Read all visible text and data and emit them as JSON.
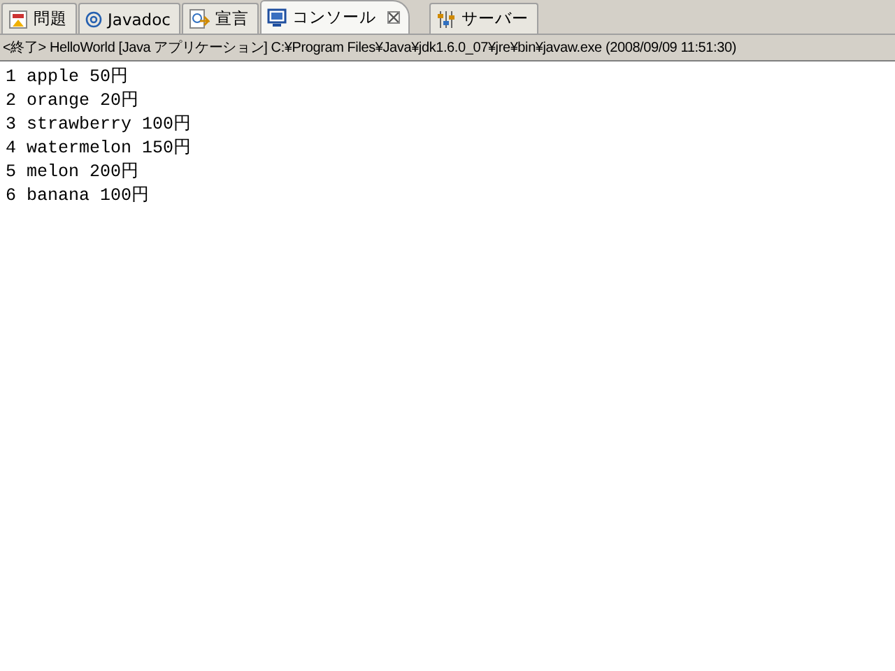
{
  "tabs": [
    {
      "label": "問題",
      "kind": "problems",
      "selected": false
    },
    {
      "label": "Javadoc",
      "kind": "javadoc",
      "selected": false
    },
    {
      "label": "宣言",
      "kind": "declaration",
      "selected": false
    },
    {
      "label": "コンソール",
      "kind": "console",
      "selected": true
    },
    {
      "label": "サーバー",
      "kind": "servers",
      "selected": false
    }
  ],
  "console": {
    "description": "<終了> HelloWorld [Java アプリケーション] C:¥Program Files¥Java¥jdk1.6.0_07¥jre¥bin¥javaw.exe (2008/09/09 11:51:30)",
    "lines": [
      "1 apple 50円",
      "2 orange 20円",
      "3 strawberry 100円",
      "4 watermelon 150円",
      "5 melon 200円",
      "6 banana 100円"
    ]
  }
}
